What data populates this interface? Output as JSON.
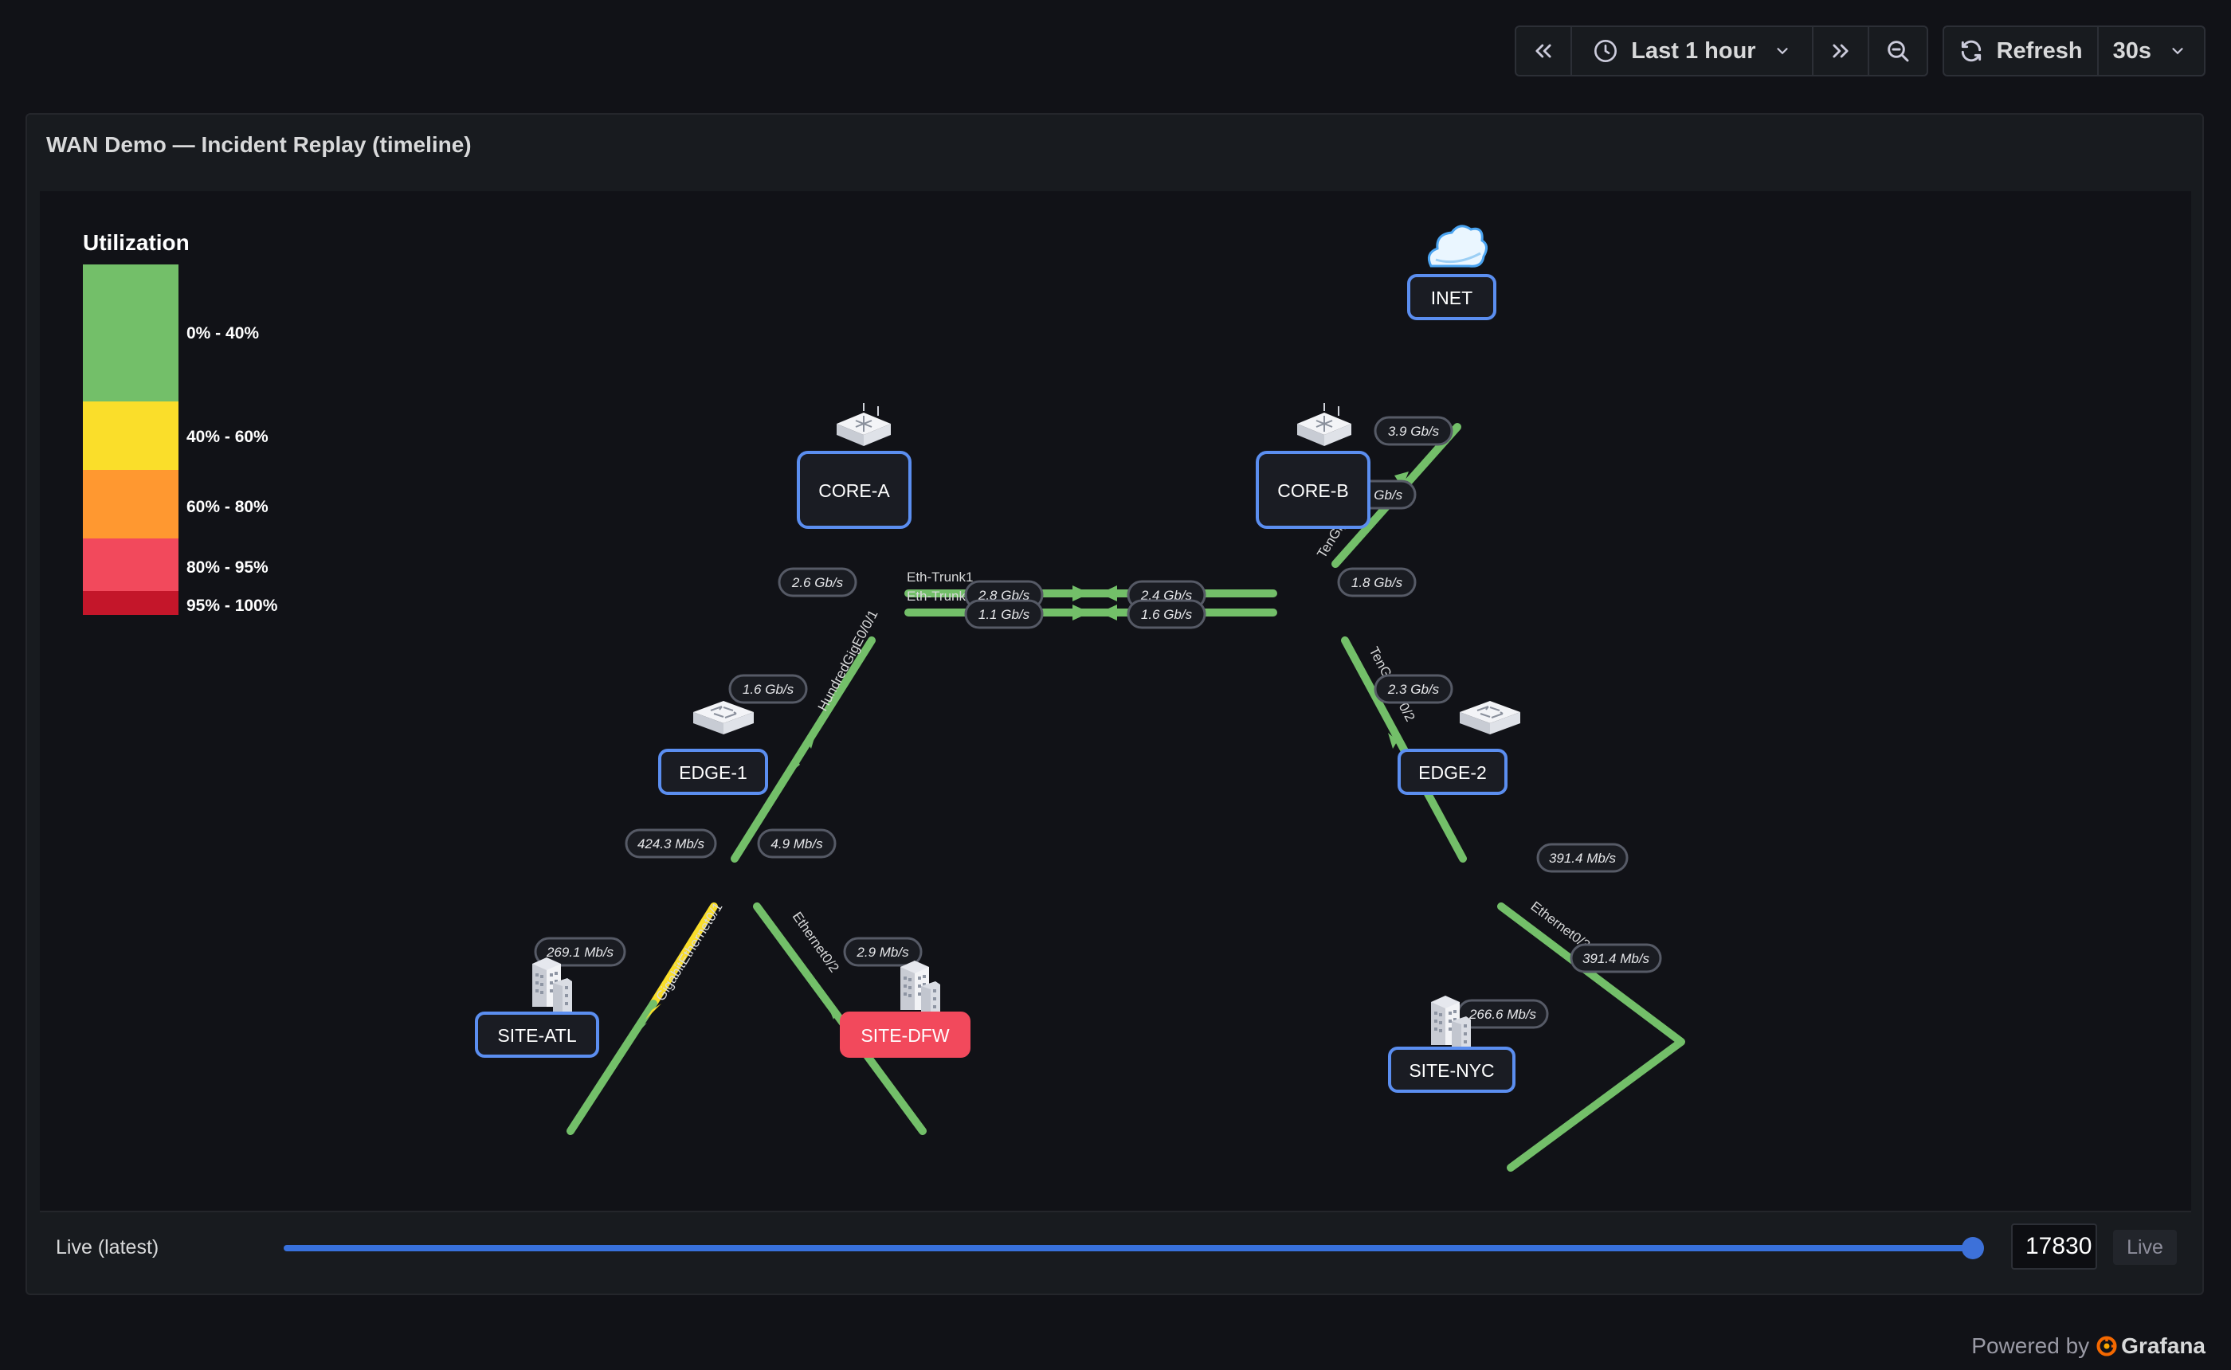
{
  "toolbar": {
    "time_range": "Last 1 hour",
    "refresh_label": "Refresh",
    "refresh_interval": "30s"
  },
  "panel": {
    "title": "WAN Demo — Incident Replay (timeline)"
  },
  "legend": {
    "title": "Utilization",
    "items": [
      {
        "label": "0% - 40%",
        "color": "#73bf69"
      },
      {
        "label": "40% - 60%",
        "color": "#fade2a"
      },
      {
        "label": "60% - 80%",
        "color": "#ff9830"
      },
      {
        "label": "80% - 95%",
        "color": "#f2495c"
      },
      {
        "label": "95% - 100%",
        "color": "#c4162a"
      }
    ]
  },
  "nodes": [
    {
      "id": "inet",
      "label": "INET",
      "icon": "cloud-icon",
      "alert": false
    },
    {
      "id": "core-a",
      "label": "CORE-A",
      "icon": "router-icon",
      "alert": false
    },
    {
      "id": "core-b",
      "label": "CORE-B",
      "icon": "router-icon",
      "alert": false
    },
    {
      "id": "edge-1",
      "label": "EDGE-1",
      "icon": "switch-icon",
      "alert": false
    },
    {
      "id": "edge-2",
      "label": "EDGE-2",
      "icon": "switch-icon",
      "alert": false
    },
    {
      "id": "site-atl",
      "label": "SITE-ATL",
      "icon": "building-icon",
      "alert": false
    },
    {
      "id": "site-dfw",
      "label": "SITE-DFW",
      "icon": "building-icon",
      "alert": true
    },
    {
      "id": "site-nyc",
      "label": "SITE-NYC",
      "icon": "building-icon",
      "alert": false
    }
  ],
  "links": [
    {
      "id": "inet-coreb",
      "from": "INET",
      "to": "CORE-B",
      "iface": "TenGigE0/0/9",
      "out": "3.9 Gb/s",
      "in": "2.2 Gb/s",
      "color": "#73bf69"
    },
    {
      "id": "corea-coreb-1",
      "from": "CORE-A",
      "to": "CORE-B",
      "iface": "Eth-Trunk1",
      "out": "2.8 Gb/s",
      "in": "2.4 Gb/s",
      "color": "#73bf69"
    },
    {
      "id": "corea-coreb-2",
      "from": "CORE-A",
      "to": "CORE-B",
      "iface": "Eth-Trunk2",
      "out": "1.1 Gb/s",
      "in": "1.6 Gb/s",
      "color": "#73bf69"
    },
    {
      "id": "corea-edge1",
      "from": "CORE-A",
      "to": "EDGE-1",
      "iface": "HundredGigE0/0/1",
      "out": "2.6 Gb/s",
      "in": "1.6 Gb/s",
      "color": "#73bf69"
    },
    {
      "id": "coreb-edge2",
      "from": "CORE-B",
      "to": "EDGE-2",
      "iface": "TenGigE0/0/2",
      "out": "1.8 Gb/s",
      "in": "2.3 Gb/s",
      "color": "#73bf69"
    },
    {
      "id": "edge1-atl",
      "from": "EDGE-1",
      "to": "SITE-ATL",
      "iface": "GigabitEthernet0/1",
      "out": "424.3 Mb/s",
      "in": "269.1 Mb/s",
      "color": "#fade2a"
    },
    {
      "id": "edge1-dfw",
      "from": "EDGE-1",
      "to": "SITE-DFW",
      "iface": "Ethernet0/2",
      "out": "4.9 Mb/s",
      "in": "2.9 Mb/s",
      "color": "#73bf69"
    },
    {
      "id": "edge2-nyc",
      "from": "EDGE-2",
      "to": "SITE-NYC",
      "iface": "Ethernet0/3",
      "out": "391.4 Mb/s",
      "mid": "391.4 Mb/s",
      "in": "266.6 Mb/s",
      "color": "#73bf69"
    }
  ],
  "timeline": {
    "label": "Live (latest)",
    "position": 1.0,
    "timestamp": "17830",
    "live_label": "Live"
  },
  "footer": {
    "powered_by": "Powered by",
    "brand": "Grafana"
  }
}
